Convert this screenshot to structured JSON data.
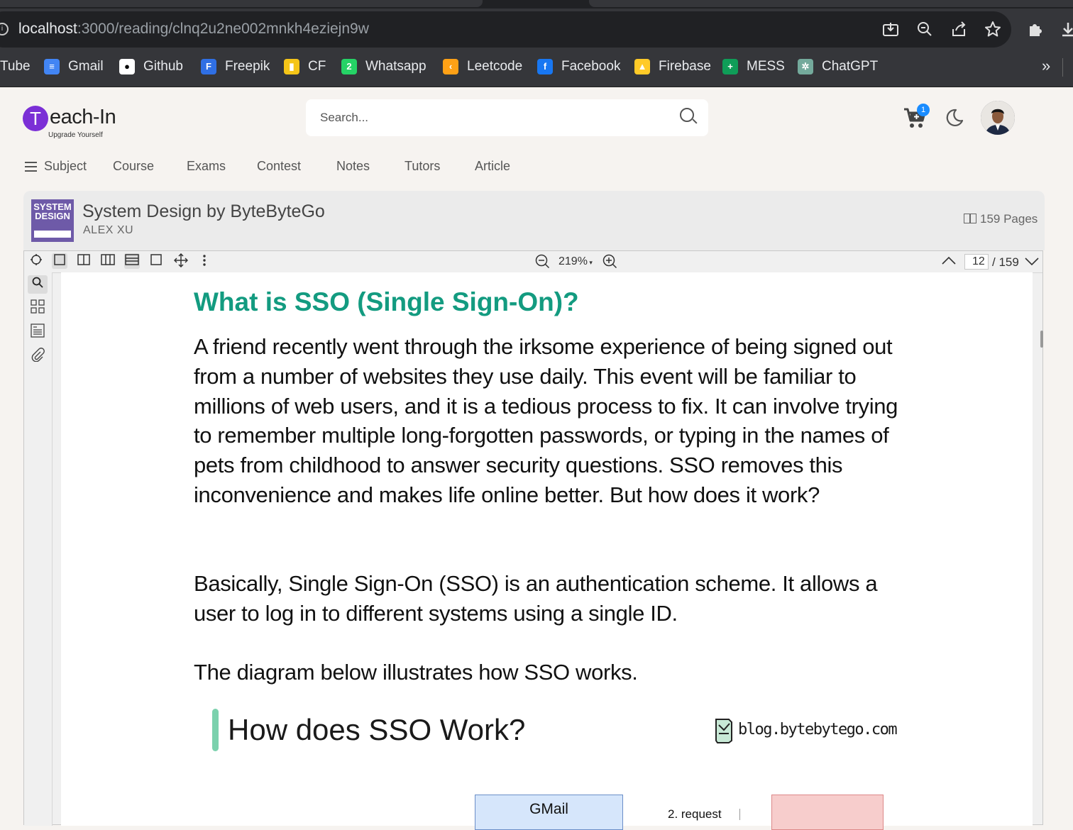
{
  "browser": {
    "url_host": "localhost",
    "url_path": ":3000/reading/clnq2u2ne002mnkh4eziejn9w",
    "bookmarks": [
      {
        "label": "Tube",
        "icon": "youtube-icon"
      },
      {
        "label": "Gmail",
        "icon": "gmail-icon",
        "color": "#4285f4"
      },
      {
        "label": "Github",
        "icon": "github-icon",
        "color": "#ffffff"
      },
      {
        "label": "Freepik",
        "icon": "freepik-icon",
        "color": "#2f6fe4"
      },
      {
        "label": "CF",
        "icon": "codeforces-icon",
        "color": "#f5c518"
      },
      {
        "label": "Whatsapp",
        "icon": "whatsapp-icon",
        "color": "#25d366"
      },
      {
        "label": "Leetcode",
        "icon": "leetcode-icon",
        "color": "#ffa116"
      },
      {
        "label": "Facebook",
        "icon": "facebook-icon",
        "color": "#1877f2"
      },
      {
        "label": "Firebase",
        "icon": "firebase-icon",
        "color": "#ffca28"
      },
      {
        "label": "MESS",
        "icon": "plus-icon",
        "color": "#0f9d58"
      },
      {
        "label": "ChatGPT",
        "icon": "chatgpt-icon",
        "color": "#74aa9c"
      }
    ],
    "more_label": "»"
  },
  "header": {
    "logo_letter": "T",
    "logo_rest": "each-In",
    "logo_tagline": "Upgrade Yourself",
    "search_placeholder": "Search...",
    "cart_count": "1"
  },
  "nav": {
    "items": [
      "Subject",
      "Course",
      "Exams",
      "Contest",
      "Notes",
      "Tutors",
      "Article"
    ]
  },
  "book": {
    "cover_line1": "SYSTEM",
    "cover_line2": "DESIGN",
    "title": "System Design by ByteByteGo",
    "author": "ALEX XU",
    "pages": "159 Pages"
  },
  "viewer": {
    "zoom": "219%",
    "current_page": "12",
    "total_pages": "/ 159"
  },
  "content": {
    "heading": "What is SSO (Single Sign-On)?",
    "paragraph1": "A friend recently went through the irksome experience of being signed out from a number of websites they use daily. This event will be familiar to millions of web users, and it is a tedious process to fix. It can involve trying to remember multiple long-forgotten passwords, or typing in the names of pets from childhood to answer security questions. SSO removes this inconvenience and makes life online better. But how does it work?",
    "paragraph2": "Basically, Single Sign-On (SSO) is an authentication scheme. It allows a user to log in to different systems using a single ID.",
    "paragraph3": "The diagram below illustrates how SSO works.",
    "diagram_title": "How does SSO Work?",
    "diagram_source": "blog.bytebytego.com",
    "diagram_box1": "GMail",
    "diagram_arrow_label": "2. request"
  },
  "colors": {
    "heading": "#139b80",
    "logo": "#7b2fd6",
    "badge": "#1a8cff"
  }
}
